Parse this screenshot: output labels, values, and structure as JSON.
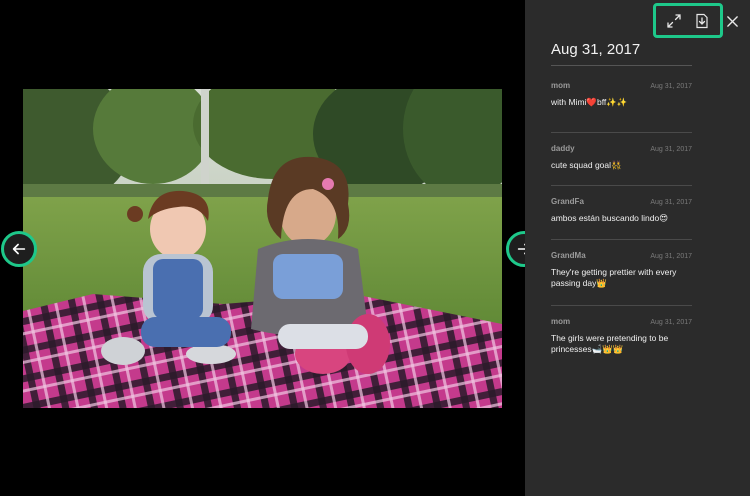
{
  "toolbar": {
    "expand_icon": "expand-arrows-icon",
    "download_icon": "download-icon",
    "close_icon": "close-icon",
    "accent": "#1ec88a"
  },
  "navigation": {
    "prev_icon": "arrow-left-icon",
    "next_icon": "arrow-right-icon"
  },
  "photo": {
    "description_icon": "photo"
  },
  "sidebar": {
    "date": "Aug 31, 2017",
    "comments": [
      {
        "author": "mom",
        "date": "Aug 31, 2017",
        "text": "with Mimi❤️bff✨✨"
      },
      {
        "author": "daddy",
        "date": "Aug 31, 2017",
        "text": "cute squad goal👯"
      },
      {
        "author": "GrandFa",
        "date": "Aug 31, 2017",
        "text": "ambos están buscando lindo😍"
      },
      {
        "author": "GrandMa",
        "date": "Aug 31, 2017",
        "text": "They're getting prettier with every passing day👑"
      },
      {
        "author": "mom",
        "date": "Aug 31, 2017",
        "text": "The girls were pretending to be princesses🛁👑👑"
      }
    ]
  }
}
